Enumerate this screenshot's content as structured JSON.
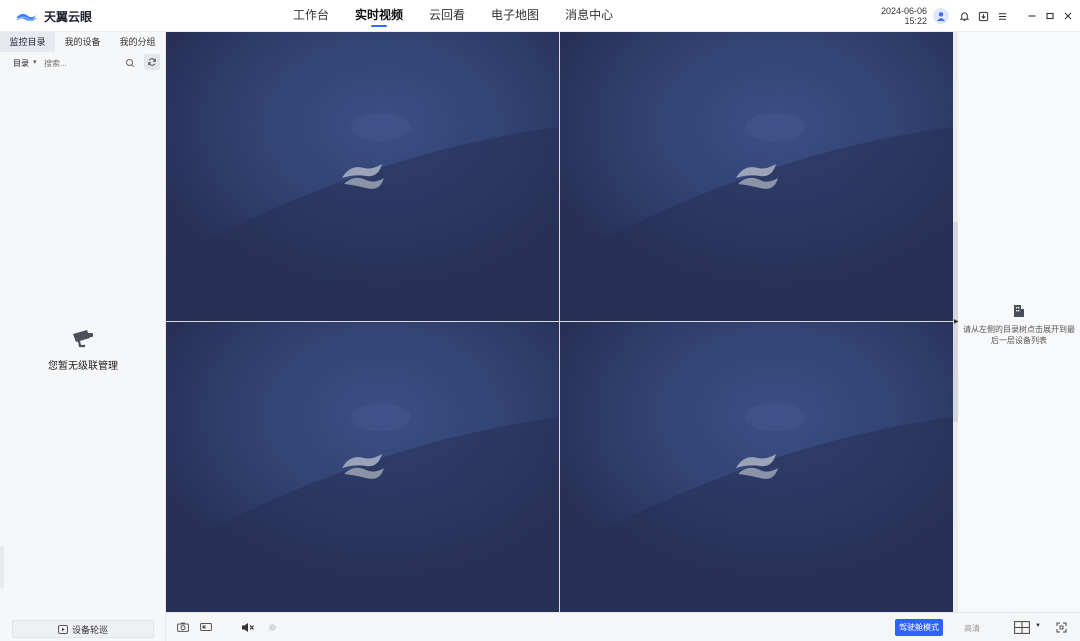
{
  "app": {
    "name": "天翼云眼"
  },
  "nav": [
    {
      "label": "工作台",
      "active": false
    },
    {
      "label": "实时视频",
      "active": true
    },
    {
      "label": "云回看",
      "active": false
    },
    {
      "label": "电子地图",
      "active": false
    },
    {
      "label": "消息中心",
      "active": false
    }
  ],
  "header": {
    "date": "2024-06-06",
    "time": "15:22"
  },
  "sidebar": {
    "tabs": [
      {
        "label": "监控目录",
        "active": true
      },
      {
        "label": "我的设备",
        "active": false
      },
      {
        "label": "我的分组",
        "active": false
      }
    ],
    "directory_label": "目录",
    "search_placeholder": "搜索...",
    "empty_text": "您暂无级联管理",
    "patrol_label": "设备轮巡"
  },
  "right_panel": {
    "hint": "请从左侧的目录树点击展开到最后一层设备列表"
  },
  "bottom": {
    "cockpit_label": "驾驶舱模式",
    "quality_label": "高清"
  },
  "colors": {
    "accent": "#2f62ff",
    "video_bg": "#2a3458",
    "selected_border": "#4d86ff"
  },
  "video_cells": [
    {
      "id": "cell-1",
      "selected": true
    },
    {
      "id": "cell-2",
      "selected": false
    },
    {
      "id": "cell-3",
      "selected": false
    },
    {
      "id": "cell-4",
      "selected": false
    }
  ]
}
